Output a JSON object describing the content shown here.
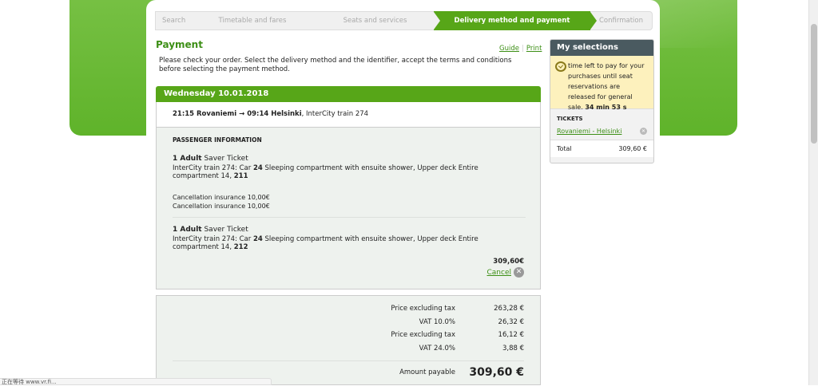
{
  "steps": [
    {
      "label": "Search"
    },
    {
      "label": "Timetable and fares"
    },
    {
      "label": "Seats and services"
    },
    {
      "label": "Delivery method and payment"
    },
    {
      "label": "Confirmation"
    }
  ],
  "page": {
    "title": "Payment",
    "guide_link": "Guide",
    "print_link": "Print",
    "intro": "Please check your order. Select the delivery method and the identifier, accept the terms and conditions before selecting the payment method."
  },
  "journey": {
    "date": "Wednesday 10.01.2018",
    "route_bold": "21:15 Rovaniemi → 09:14 Helsinki",
    "route_train": ", InterCity train 274",
    "passenger_title": "PASSENGER INFORMATION",
    "tickets": [
      {
        "qty": "1 Adult",
        "type": " Saver Ticket",
        "desc_a": "InterCity train 274: Car ",
        "car": "24",
        "desc_b": " Sleeping compartment with ensuite shower, Upper deck Entire compartment 14, ",
        "seat": "211",
        "insurance": [
          "Cancellation insurance 10,00€",
          "Cancellation insurance 10,00€"
        ]
      },
      {
        "qty": "1 Adult",
        "type": " Saver Ticket",
        "desc_a": "InterCity train 274: Car ",
        "car": "24",
        "desc_b": " Sleeping compartment with ensuite shower, Upper deck Entire compartment 14, ",
        "seat": "212"
      }
    ],
    "total": "309,60€",
    "cancel_label": "Cancel"
  },
  "prices": {
    "rows": [
      {
        "label": "Price excluding tax",
        "value": "263,28 €"
      },
      {
        "label": "VAT 10.0%",
        "value": "26,32 €"
      },
      {
        "label": "Price excluding tax",
        "value": "16,12 €"
      },
      {
        "label": "VAT 24.0%",
        "value": "3,88 €"
      }
    ],
    "amount_label": "Amount payable",
    "amount_value": "309,60 €"
  },
  "selections": {
    "title": "My selections",
    "timer_text": "time left to pay for your purchases until seat reservations are released for general sale.",
    "timer_value": "34 min 53 s",
    "tickets_label": "TICKETS",
    "ticket_link": "Rovaniemi - Helsinki",
    "total_label": "Total",
    "total_value": "309,60 €"
  },
  "status_bar": "正在等待 www.vr.fi..."
}
